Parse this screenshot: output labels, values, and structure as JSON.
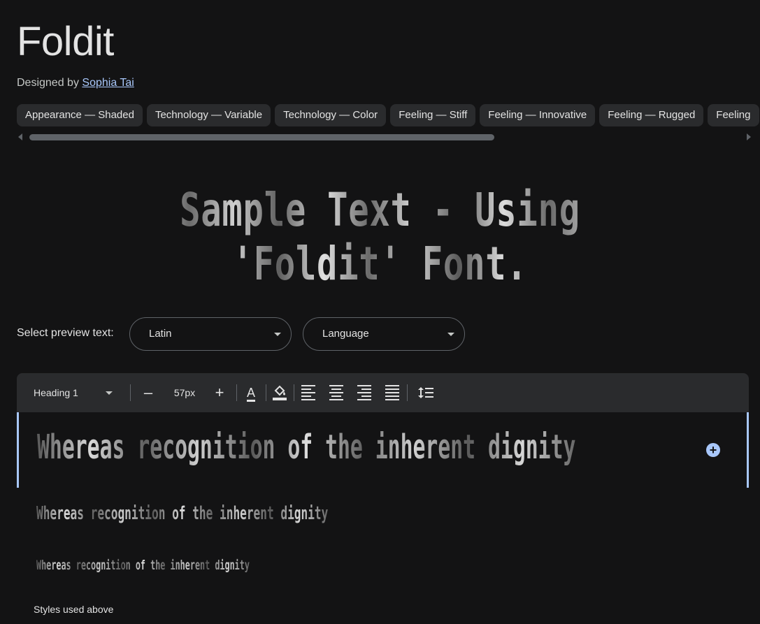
{
  "font": {
    "name": "Foldit",
    "designed_by_prefix": "Designed by",
    "designer": "Sophia Tai"
  },
  "tags": [
    "Appearance — Shaded",
    "Technology — Variable",
    "Technology — Color",
    "Feeling — Stiff",
    "Feeling — Innovative",
    "Feeling — Rugged",
    "Feeling"
  ],
  "sample_text": "Sample Text - Using 'Foldit' Font.",
  "preview": {
    "label": "Select preview text:",
    "script_value": "Latin",
    "language_value": "Language"
  },
  "toolbar": {
    "style_value": "Heading 1",
    "decrease": "–",
    "size_value": "57px",
    "increase": "+",
    "text_color_glyph": "A"
  },
  "editor": {
    "line1": "Whereas recognition of the inherent dignity",
    "line2": "Whereas recognition of the inherent dignity",
    "line3": "Whereas recognition of the inherent dignity",
    "add_glyph": "+"
  },
  "styles_used_label": "Styles used above",
  "colors": {
    "background": "#131314",
    "chip": "#2a2b2d",
    "accent": "#a8c7fa"
  }
}
